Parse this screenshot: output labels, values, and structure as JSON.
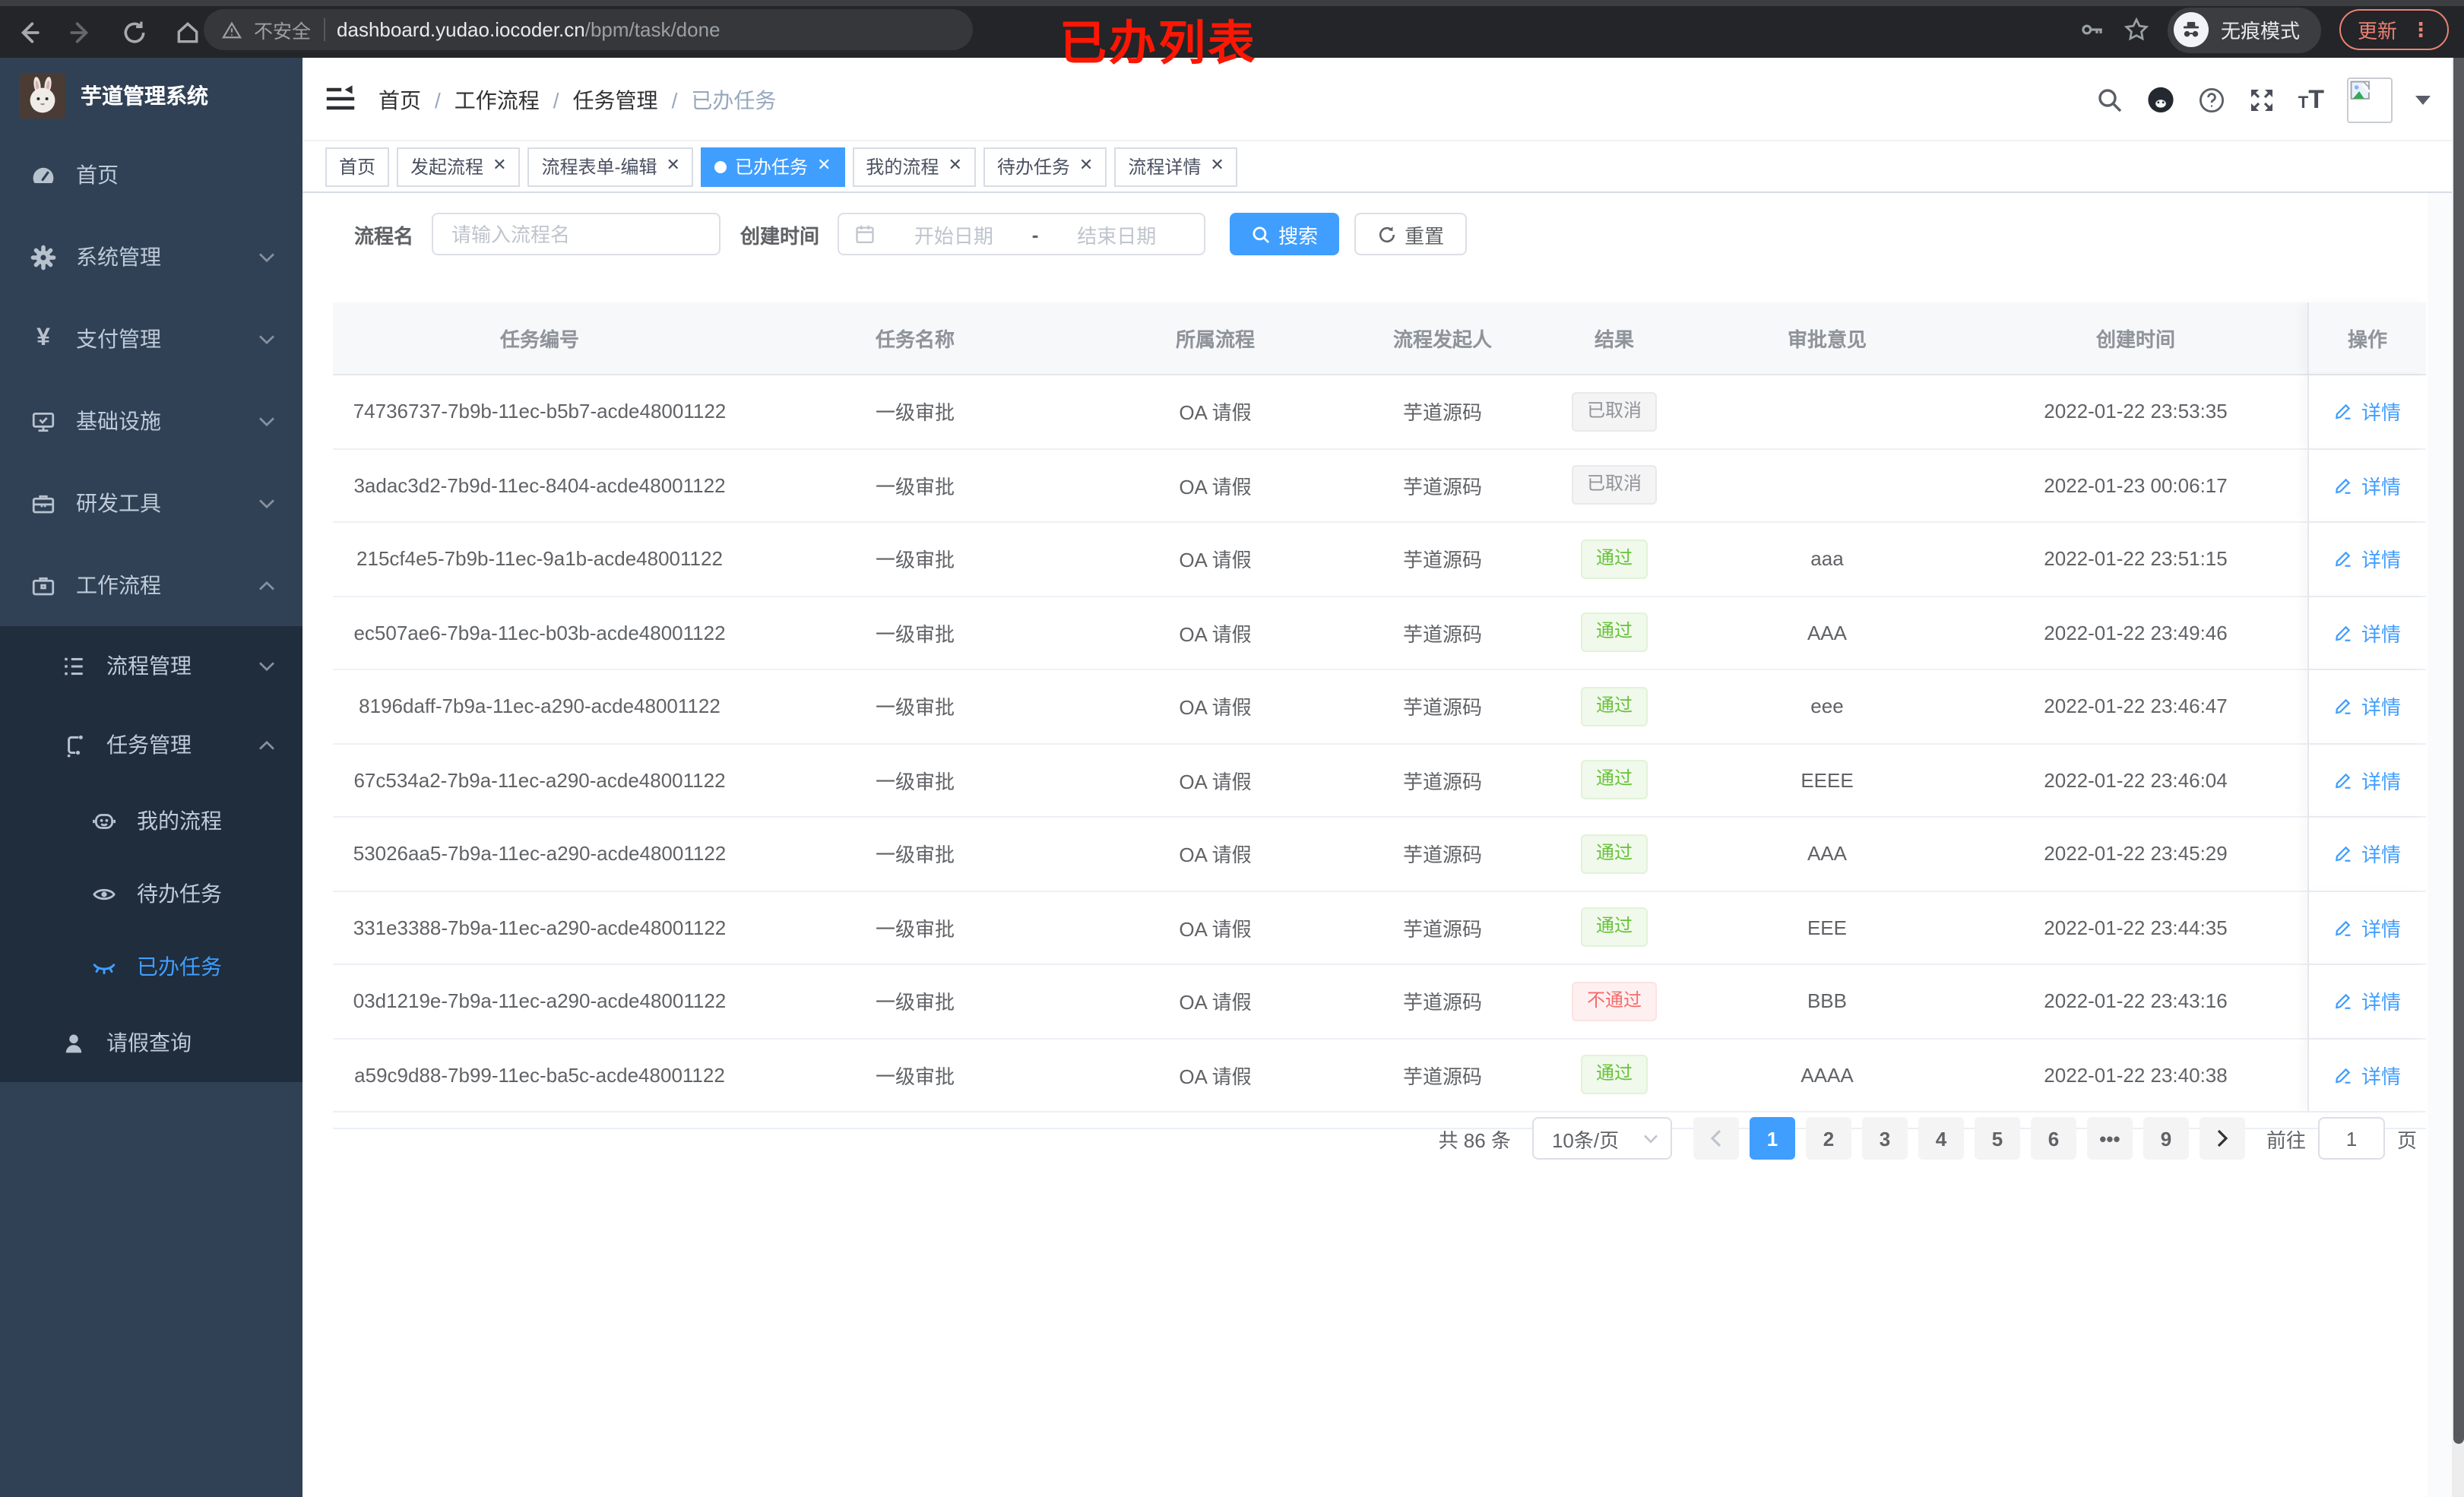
{
  "browser": {
    "security": "不安全",
    "domain": "dashboard.yudao.iocoder.cn",
    "path": "/bpm/task/done",
    "annotation": "已办列表",
    "incognito_label": "无痕模式",
    "update_label": "更新",
    "menu_dots": "⋮"
  },
  "sidebar": {
    "title": "芋道管理系统",
    "menu": [
      {
        "label": "首页",
        "icon": "dashboard-icon",
        "level": 1
      },
      {
        "label": "系统管理",
        "icon": "gear-icon",
        "level": 1,
        "chevron": "down"
      },
      {
        "label": "支付管理",
        "icon": "yen-icon",
        "level": 1,
        "chevron": "down"
      },
      {
        "label": "基础设施",
        "icon": "monitor-icon",
        "level": 1,
        "chevron": "down"
      },
      {
        "label": "研发工具",
        "icon": "toolbox-icon",
        "level": 1,
        "chevron": "down"
      },
      {
        "label": "工作流程",
        "icon": "briefcase-icon",
        "level": 1,
        "chevron": "up"
      },
      {
        "label": "流程管理",
        "icon": "tree-icon",
        "level": 2,
        "chevron": "down"
      },
      {
        "label": "任务管理",
        "icon": "branch-icon",
        "level": 2,
        "chevron": "up"
      },
      {
        "label": "我的流程",
        "icon": "robot-icon",
        "level": 3
      },
      {
        "label": "待办任务",
        "icon": "eye-icon",
        "level": 3
      },
      {
        "label": "已办任务",
        "icon": "eye-closed-icon",
        "level": 3,
        "active": true
      },
      {
        "label": "请假查询",
        "icon": "user-icon",
        "level": 2
      }
    ]
  },
  "breadcrumb": {
    "separator": "/",
    "items": [
      {
        "label": "首页"
      },
      {
        "label": "工作流程"
      },
      {
        "label": "任务管理"
      },
      {
        "label": "已办任务",
        "last": true
      }
    ]
  },
  "tabs": [
    {
      "label": "首页"
    },
    {
      "label": "发起流程",
      "closable": true
    },
    {
      "label": "流程表单-编辑",
      "closable": true
    },
    {
      "label": "已办任务",
      "closable": true,
      "active": true
    },
    {
      "label": "我的流程",
      "closable": true
    },
    {
      "label": "待办任务",
      "closable": true
    },
    {
      "label": "流程详情",
      "closable": true
    }
  ],
  "filters": {
    "name_label": "流程名",
    "name_placeholder": "请输入流程名",
    "time_label": "创建时间",
    "start_placeholder": "开始日期",
    "range_separator": "-",
    "end_placeholder": "结束日期",
    "search_label": "搜索",
    "reset_label": "重置"
  },
  "table": {
    "columns": [
      {
        "label": "任务编号"
      },
      {
        "label": "任务名称"
      },
      {
        "label": "所属流程"
      },
      {
        "label": "流程发起人"
      },
      {
        "label": "结果"
      },
      {
        "label": "审批意见"
      },
      {
        "label": "创建时间"
      },
      {
        "label": "操作",
        "fixed": true
      }
    ],
    "action_label": "详情",
    "rows": [
      {
        "id": "74736737-7b9b-11ec-b5b7-acde48001122",
        "name": "一级审批",
        "flow": "OA 请假",
        "starter": "芋道源码",
        "result": "已取消",
        "result_type": "info",
        "comment": "",
        "time": "2022-01-22 23:53:35"
      },
      {
        "id": "3adac3d2-7b9d-11ec-8404-acde48001122",
        "name": "一级审批",
        "flow": "OA 请假",
        "starter": "芋道源码",
        "result": "已取消",
        "result_type": "info",
        "comment": "",
        "time": "2022-01-23 00:06:17"
      },
      {
        "id": "215cf4e5-7b9b-11ec-9a1b-acde48001122",
        "name": "一级审批",
        "flow": "OA 请假",
        "starter": "芋道源码",
        "result": "通过",
        "result_type": "success",
        "comment": "aaa",
        "time": "2022-01-22 23:51:15"
      },
      {
        "id": "ec507ae6-7b9a-11ec-b03b-acde48001122",
        "name": "一级审批",
        "flow": "OA 请假",
        "starter": "芋道源码",
        "result": "通过",
        "result_type": "success",
        "comment": "AAA",
        "time": "2022-01-22 23:49:46"
      },
      {
        "id": "8196daff-7b9a-11ec-a290-acde48001122",
        "name": "一级审批",
        "flow": "OA 请假",
        "starter": "芋道源码",
        "result": "通过",
        "result_type": "success",
        "comment": "eee",
        "time": "2022-01-22 23:46:47"
      },
      {
        "id": "67c534a2-7b9a-11ec-a290-acde48001122",
        "name": "一级审批",
        "flow": "OA 请假",
        "starter": "芋道源码",
        "result": "通过",
        "result_type": "success",
        "comment": "EEEE",
        "time": "2022-01-22 23:46:04"
      },
      {
        "id": "53026aa5-7b9a-11ec-a290-acde48001122",
        "name": "一级审批",
        "flow": "OA 请假",
        "starter": "芋道源码",
        "result": "通过",
        "result_type": "success",
        "comment": "AAA",
        "time": "2022-01-22 23:45:29"
      },
      {
        "id": "331e3388-7b9a-11ec-a290-acde48001122",
        "name": "一级审批",
        "flow": "OA 请假",
        "starter": "芋道源码",
        "result": "通过",
        "result_type": "success",
        "comment": "EEE",
        "time": "2022-01-22 23:44:35"
      },
      {
        "id": "03d1219e-7b9a-11ec-a290-acde48001122",
        "name": "一级审批",
        "flow": "OA 请假",
        "starter": "芋道源码",
        "result": "不通过",
        "result_type": "danger",
        "comment": "BBB",
        "time": "2022-01-22 23:43:16"
      },
      {
        "id": "a59c9d88-7b99-11ec-ba5c-acde48001122",
        "name": "一级审批",
        "flow": "OA 请假",
        "starter": "芋道源码",
        "result": "通过",
        "result_type": "success",
        "comment": "AAAA",
        "time": "2022-01-22 23:40:38"
      }
    ]
  },
  "pagination": {
    "total": "共 86 条",
    "page_size": "10条/页",
    "pages": [
      {
        "label": "1",
        "active": true
      },
      {
        "label": "2"
      },
      {
        "label": "3"
      },
      {
        "label": "4"
      },
      {
        "label": "5"
      },
      {
        "label": "6"
      },
      {
        "label": "•••",
        "ellipsis": true
      },
      {
        "label": "9"
      }
    ],
    "goto_label": "前往",
    "goto_value": "1",
    "goto_unit": "页"
  },
  "colors": {
    "accent": "#409eff",
    "success": "#67c23a",
    "danger": "#f56c6c",
    "info": "#909399",
    "sidebar": "#304156",
    "sidebar_sub": "#1f2d3d"
  }
}
